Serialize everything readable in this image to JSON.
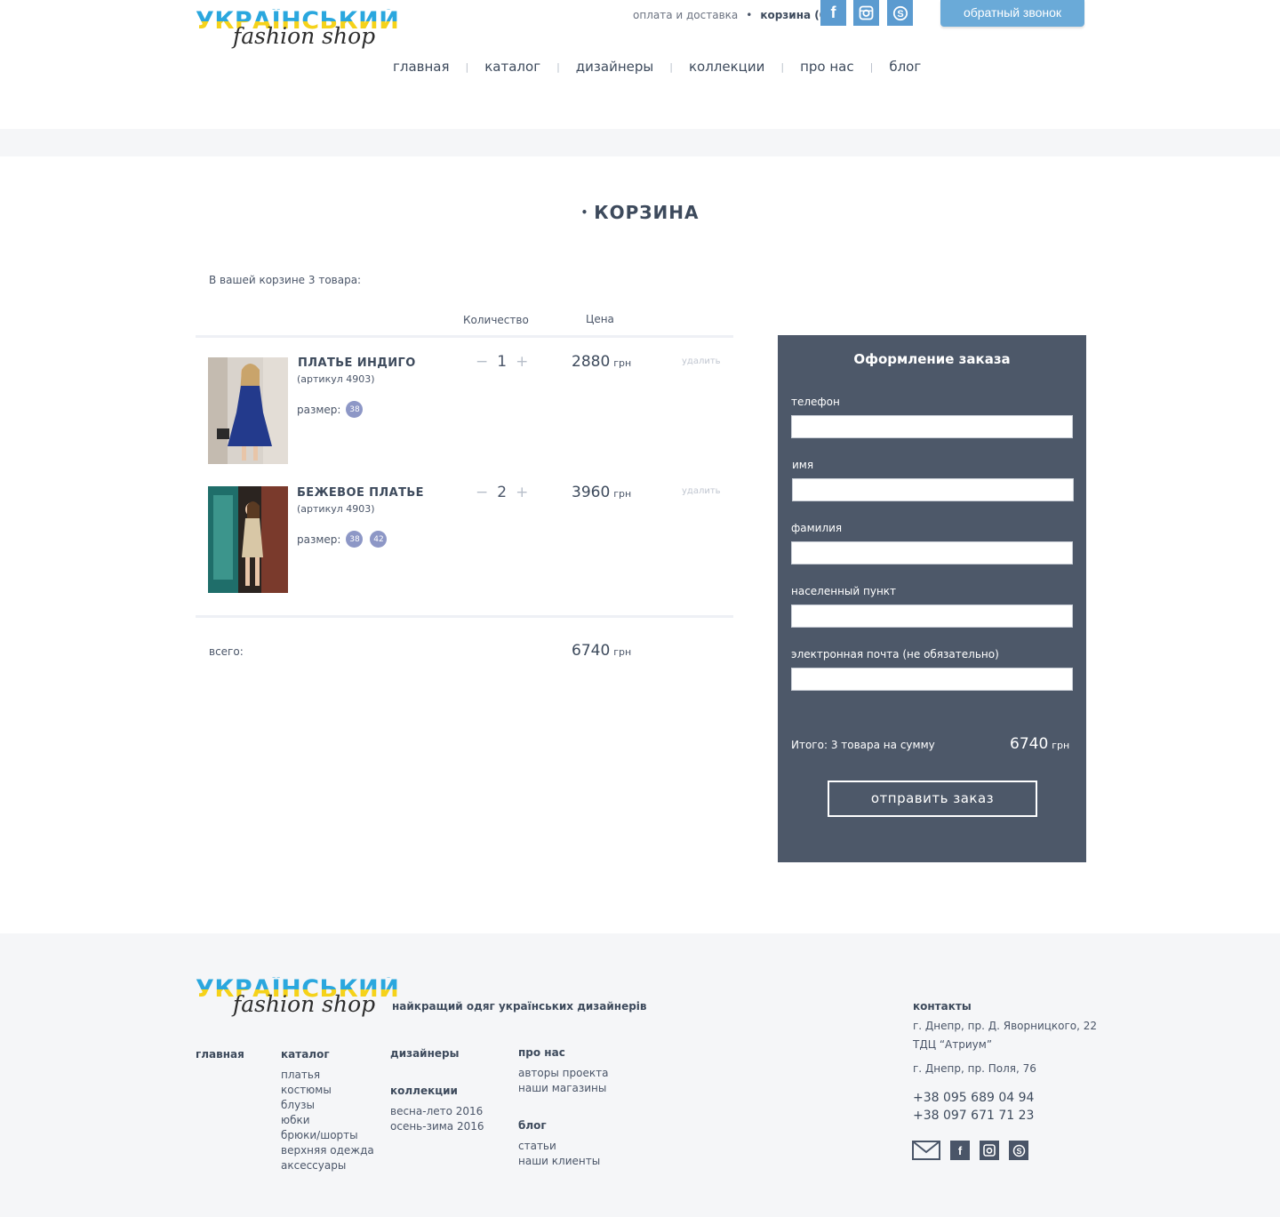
{
  "header": {
    "logo": {
      "line1": "УКРАЇНСЬКИЙ",
      "line2": "fashion shop"
    },
    "toplinks": {
      "delivery": "оплата и доставка",
      "cart": "корзина (0)"
    },
    "social": [
      "facebook-icon",
      "instagram-icon",
      "skype-icon"
    ],
    "callback_label": "обратный звонок",
    "nav": [
      "главная",
      "каталог",
      "дизайнеры",
      "коллекции",
      "про нас",
      "блог"
    ]
  },
  "page": {
    "title": "КОРЗИНА",
    "cart_count_text": "В вашей корзине 3 товара:",
    "col_qty": "Количество",
    "col_price": "Цена",
    "items": [
      {
        "title": "ПЛАТЬЕ ИНДИГО",
        "sku": "(артикул 4903)",
        "size_label": "размер:",
        "sizes": [
          "38"
        ],
        "qty": "1",
        "price": "2880",
        "currency": "грн",
        "delete": "удалить"
      },
      {
        "title": "БЕЖЕВОЕ ПЛАТЬЕ",
        "sku": "(артикул 4903)",
        "size_label": "размер:",
        "sizes": [
          "38",
          "42"
        ],
        "qty": "2",
        "price": "3960",
        "currency": "грн",
        "delete": "удалить"
      }
    ],
    "total_label": "всего:",
    "total_value": "6740",
    "total_currency": "грн"
  },
  "order": {
    "title": "Оформление заказа",
    "fields": [
      {
        "label": "телефон",
        "value": ""
      },
      {
        "label": "имя",
        "value": ""
      },
      {
        "label": "фамилия",
        "value": ""
      },
      {
        "label": "населенный пункт",
        "value": ""
      },
      {
        "label": "электронная почта (не обязательно)",
        "value": ""
      }
    ],
    "summary_text": "Итого: 3 товара на сумму",
    "summary_value": "6740",
    "summary_currency": "грн",
    "submit_label": "отправить заказ"
  },
  "footer": {
    "slogan": "найкращий одяг українських дизайнерів",
    "col_main": "главная",
    "col_catalog": {
      "title": "каталог",
      "items": [
        "платья",
        "костюмы",
        "блузы",
        "юбки",
        "брюки/шорты",
        "верхняя одежда",
        "аксессуары"
      ]
    },
    "col_designers": "дизайнеры",
    "col_collections": {
      "title": "коллекции",
      "items": [
        "весна-лето 2016",
        "осень-зима 2016"
      ]
    },
    "col_about": {
      "title": "про нас",
      "items": [
        "авторы проекта",
        "наши магазины"
      ]
    },
    "col_blog": {
      "title": "блог",
      "items": [
        "статьи",
        "наши клиенты"
      ]
    },
    "contacts": {
      "title": "контакты",
      "addr1_line1": "г. Днепр, пр. Д. Яворницкого, 22",
      "addr1_line2": "ТДЦ “Атриум”",
      "addr2": "г. Днепр, пр. Поля, 76",
      "phone1": "+38 095 689 04 94",
      "phone2": "+38 097 671 71 23"
    },
    "social": [
      "mail-icon",
      "facebook-icon",
      "instagram-icon",
      "skype-icon"
    ]
  },
  "colors": {
    "accent": "#6aaad8",
    "dark": "#4d5869",
    "text": "#3d4a5c",
    "badge": "#8d97c6"
  }
}
